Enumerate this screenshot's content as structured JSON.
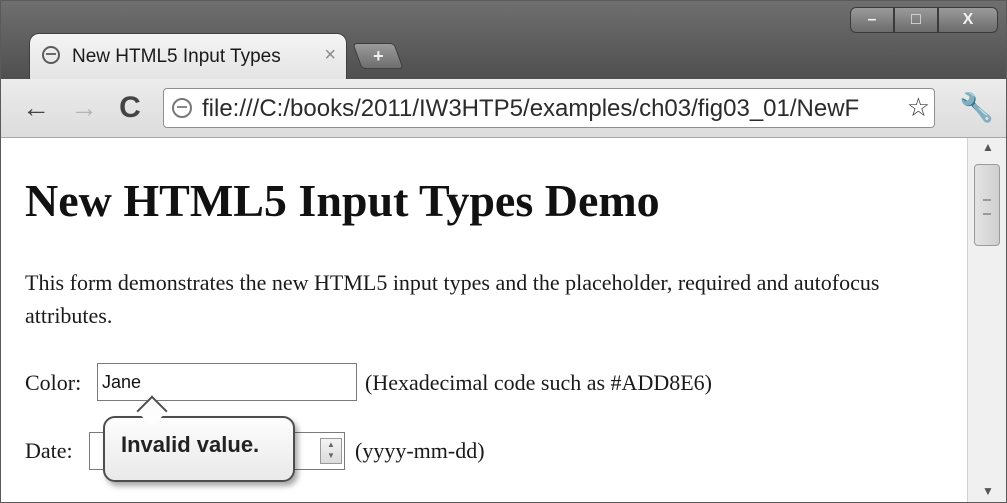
{
  "window": {
    "controls": {
      "minimize": "–",
      "maximize": "□",
      "close": "X"
    }
  },
  "tab": {
    "title": "New HTML5 Input Types",
    "close_label": "×",
    "new_tab_label": "+"
  },
  "toolbar": {
    "back_label": "←",
    "forward_label": "→",
    "reload_label": "C",
    "url": "file:///C:/books/2011/IW3HTP5/examples/ch03/fig03_01/NewF",
    "star_label": "☆",
    "wrench_label": "🔧"
  },
  "page": {
    "heading": "New HTML5 Input Types Demo",
    "intro": "This form demonstrates the new HTML5 input types and the placeholder, required and autofocus attributes.",
    "color": {
      "label": "Color:",
      "value": "Jane",
      "hint": "(Hexadecimal code such as #ADD8E6)"
    },
    "date": {
      "label": "Date:",
      "hint": "(yyyy-mm-dd)"
    },
    "validation_message": "Invalid value."
  },
  "scrollbar": {
    "up_label": "▲",
    "down_label": "▼"
  }
}
